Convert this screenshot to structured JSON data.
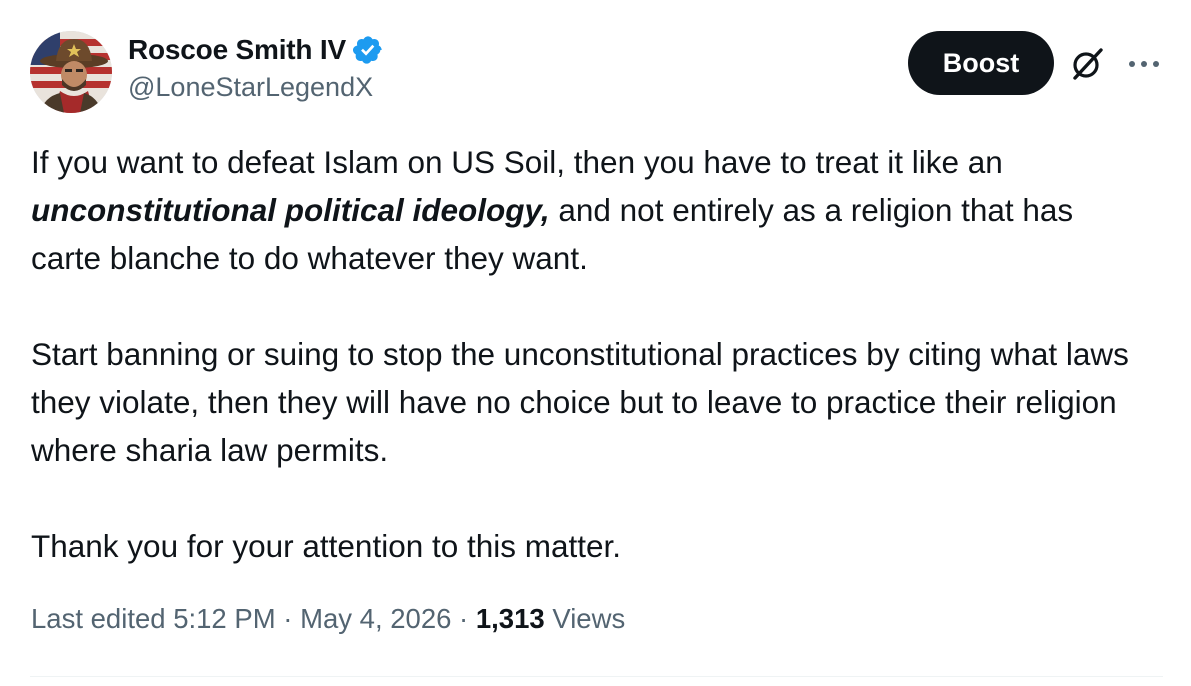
{
  "author": {
    "display_name": "Roscoe Smith IV",
    "handle": "@LoneStarLegendX",
    "verified": true,
    "avatar_icon": "avatar-cowboy-flag"
  },
  "actions": {
    "boost_label": "Boost",
    "grok_icon": "grok-icon",
    "more_icon": "more-icon"
  },
  "body": {
    "p1_line1": "If you want to defeat Islam on US Soil, then you have to treat it like an",
    "p1_emph": "unconstitutional political ideology,",
    "p1_rest": " and not entirely as a religion that has carte blanche to do whatever they want.",
    "p2": "Start banning or suing to stop the unconstitutional practices by citing what laws they violate, then they will have no choice but to leave to practice their religion where sharia law permits.",
    "p3": "Thank you for your attention to this matter."
  },
  "meta": {
    "edited_prefix": "Last edited ",
    "time": "5:12 PM",
    "separator": " · ",
    "date": "May 4, 2026",
    "views_count": "1,313",
    "views_label": " Views"
  },
  "colors": {
    "text": "#0f1419",
    "secondary": "#536471",
    "verified_blue": "#1d9bf0",
    "boost_bg": "#0f1419"
  }
}
